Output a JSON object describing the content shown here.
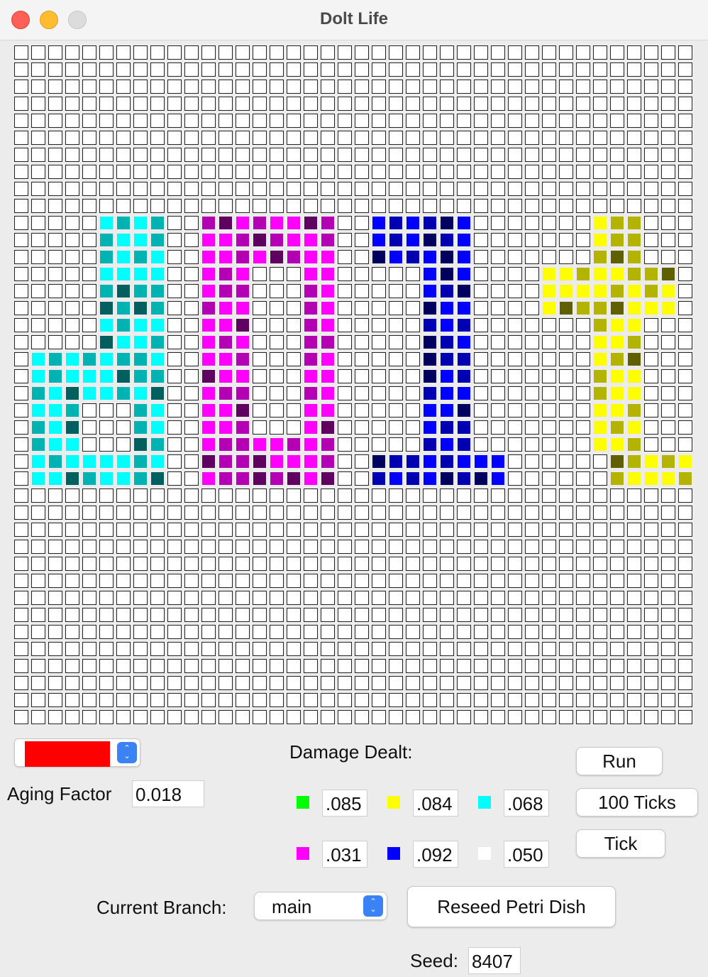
{
  "window": {
    "title": "Dolt Life"
  },
  "grid": {
    "cols": 40,
    "rows": 40,
    "palette": {
      "c1": "#00ffff",
      "c2": "#00b3b3",
      "c3": "#006060",
      "m1": "#ff00ff",
      "m2": "#b300b3",
      "m3": "#600060",
      "b1": "#0000ff",
      "b2": "#0000b3",
      "b3": "#000060",
      "y1": "#ffff00",
      "y2": "#b3b300",
      "y3": "#606000"
    },
    "live_rows": {
      "10": [
        [
          5,
          "c1"
        ],
        [
          6,
          "c2"
        ],
        [
          7,
          "c1"
        ],
        [
          8,
          "c2"
        ],
        [
          11,
          "m2"
        ],
        [
          12,
          "m3"
        ],
        [
          13,
          "m1"
        ],
        [
          14,
          "m2"
        ],
        [
          15,
          "m1"
        ],
        [
          16,
          "m1"
        ],
        [
          17,
          "m3"
        ],
        [
          18,
          "m2"
        ],
        [
          21,
          "b1"
        ],
        [
          22,
          "b2"
        ],
        [
          23,
          "b1"
        ],
        [
          24,
          "b2"
        ],
        [
          25,
          "b3"
        ],
        [
          26,
          "b1"
        ],
        [
          34,
          "y1"
        ],
        [
          35,
          "y2"
        ],
        [
          36,
          "y2"
        ]
      ],
      "11": [
        [
          5,
          "c2"
        ],
        [
          6,
          "c1"
        ],
        [
          7,
          "c1"
        ],
        [
          8,
          "c2"
        ],
        [
          11,
          "m1"
        ],
        [
          12,
          "m1"
        ],
        [
          13,
          "m2"
        ],
        [
          14,
          "m3"
        ],
        [
          15,
          "m2"
        ],
        [
          16,
          "m1"
        ],
        [
          17,
          "m1"
        ],
        [
          18,
          "m2"
        ],
        [
          21,
          "b1"
        ],
        [
          22,
          "b2"
        ],
        [
          23,
          "b1"
        ],
        [
          24,
          "b3"
        ],
        [
          25,
          "b2"
        ],
        [
          26,
          "b1"
        ],
        [
          34,
          "y1"
        ],
        [
          35,
          "y2"
        ],
        [
          36,
          "y2"
        ]
      ],
      "12": [
        [
          5,
          "c2"
        ],
        [
          6,
          "c1"
        ],
        [
          7,
          "c2"
        ],
        [
          8,
          "c1"
        ],
        [
          11,
          "m1"
        ],
        [
          12,
          "m1"
        ],
        [
          13,
          "m2"
        ],
        [
          14,
          "m1"
        ],
        [
          15,
          "m3"
        ],
        [
          16,
          "m2"
        ],
        [
          17,
          "m1"
        ],
        [
          18,
          "m1"
        ],
        [
          21,
          "b3"
        ],
        [
          22,
          "b1"
        ],
        [
          23,
          "b2"
        ],
        [
          24,
          "b1"
        ],
        [
          25,
          "b3"
        ],
        [
          26,
          "b1"
        ],
        [
          34,
          "y2"
        ],
        [
          35,
          "y3"
        ],
        [
          36,
          "y2"
        ]
      ],
      "13": [
        [
          5,
          "c1"
        ],
        [
          6,
          "c1"
        ],
        [
          7,
          "c1"
        ],
        [
          8,
          "c1"
        ],
        [
          11,
          "m1"
        ],
        [
          12,
          "m2"
        ],
        [
          13,
          "m1"
        ],
        [
          17,
          "m1"
        ],
        [
          18,
          "m1"
        ],
        [
          24,
          "b1"
        ],
        [
          25,
          "b3"
        ],
        [
          26,
          "b1"
        ],
        [
          31,
          "y1"
        ],
        [
          32,
          "y1"
        ],
        [
          33,
          "y2"
        ],
        [
          34,
          "y1"
        ],
        [
          35,
          "y1"
        ],
        [
          36,
          "y2"
        ],
        [
          37,
          "y2"
        ],
        [
          38,
          "y3"
        ]
      ],
      "14": [
        [
          5,
          "c2"
        ],
        [
          6,
          "c3"
        ],
        [
          7,
          "c2"
        ],
        [
          8,
          "c2"
        ],
        [
          11,
          "m1"
        ],
        [
          12,
          "m2"
        ],
        [
          13,
          "m2"
        ],
        [
          17,
          "m2"
        ],
        [
          18,
          "m1"
        ],
        [
          24,
          "b1"
        ],
        [
          25,
          "b2"
        ],
        [
          26,
          "b3"
        ],
        [
          31,
          "y1"
        ],
        [
          32,
          "y1"
        ],
        [
          33,
          "y1"
        ],
        [
          34,
          "y1"
        ],
        [
          35,
          "y2"
        ],
        [
          36,
          "y1"
        ],
        [
          37,
          "y2"
        ],
        [
          38,
          "y1"
        ]
      ],
      "15": [
        [
          5,
          "c3"
        ],
        [
          6,
          "c2"
        ],
        [
          7,
          "c3"
        ],
        [
          8,
          "c2"
        ],
        [
          11,
          "m2"
        ],
        [
          12,
          "m1"
        ],
        [
          13,
          "m1"
        ],
        [
          17,
          "m2"
        ],
        [
          18,
          "m1"
        ],
        [
          24,
          "b3"
        ],
        [
          25,
          "b1"
        ],
        [
          26,
          "b1"
        ],
        [
          31,
          "y1"
        ],
        [
          32,
          "y3"
        ],
        [
          33,
          "y2"
        ],
        [
          34,
          "y2"
        ],
        [
          35,
          "y3"
        ],
        [
          36,
          "y1"
        ],
        [
          37,
          "y1"
        ],
        [
          38,
          "y1"
        ]
      ],
      "16": [
        [
          5,
          "c1"
        ],
        [
          6,
          "c2"
        ],
        [
          7,
          "c1"
        ],
        [
          8,
          "c1"
        ],
        [
          11,
          "m1"
        ],
        [
          12,
          "m1"
        ],
        [
          13,
          "m3"
        ],
        [
          17,
          "m2"
        ],
        [
          18,
          "m1"
        ],
        [
          24,
          "b2"
        ],
        [
          25,
          "b1"
        ],
        [
          26,
          "b2"
        ],
        [
          34,
          "y2"
        ],
        [
          35,
          "y1"
        ],
        [
          36,
          "y1"
        ]
      ],
      "17": [
        [
          5,
          "c3"
        ],
        [
          6,
          "c1"
        ],
        [
          7,
          "c1"
        ],
        [
          8,
          "c2"
        ],
        [
          11,
          "m1"
        ],
        [
          12,
          "m2"
        ],
        [
          13,
          "m1"
        ],
        [
          17,
          "m2"
        ],
        [
          18,
          "m2"
        ],
        [
          24,
          "b3"
        ],
        [
          25,
          "b2"
        ],
        [
          26,
          "b1"
        ],
        [
          34,
          "y1"
        ],
        [
          35,
          "y1"
        ],
        [
          36,
          "y2"
        ]
      ],
      "18": [
        [
          1,
          "c1"
        ],
        [
          2,
          "c2"
        ],
        [
          3,
          "c1"
        ],
        [
          4,
          "c2"
        ],
        [
          5,
          "c1"
        ],
        [
          6,
          "c2"
        ],
        [
          7,
          "c2"
        ],
        [
          8,
          "c1"
        ],
        [
          11,
          "m1"
        ],
        [
          12,
          "m1"
        ],
        [
          13,
          "m2"
        ],
        [
          17,
          "m2"
        ],
        [
          18,
          "m1"
        ],
        [
          24,
          "b3"
        ],
        [
          25,
          "b2"
        ],
        [
          26,
          "b2"
        ],
        [
          34,
          "y1"
        ],
        [
          35,
          "y2"
        ],
        [
          36,
          "y3"
        ]
      ],
      "19": [
        [
          1,
          "c1"
        ],
        [
          2,
          "c2"
        ],
        [
          3,
          "c1"
        ],
        [
          4,
          "c1"
        ],
        [
          5,
          "c1"
        ],
        [
          6,
          "c3"
        ],
        [
          7,
          "c2"
        ],
        [
          8,
          "c2"
        ],
        [
          11,
          "m3"
        ],
        [
          12,
          "m1"
        ],
        [
          13,
          "m1"
        ],
        [
          17,
          "m1"
        ],
        [
          18,
          "m1"
        ],
        [
          24,
          "b3"
        ],
        [
          25,
          "b1"
        ],
        [
          26,
          "b2"
        ],
        [
          34,
          "y2"
        ],
        [
          35,
          "y1"
        ],
        [
          36,
          "y1"
        ]
      ],
      "20": [
        [
          1,
          "c2"
        ],
        [
          2,
          "c1"
        ],
        [
          3,
          "c3"
        ],
        [
          4,
          "c1"
        ],
        [
          5,
          "c1"
        ],
        [
          6,
          "c2"
        ],
        [
          7,
          "c1"
        ],
        [
          8,
          "c3"
        ],
        [
          11,
          "m1"
        ],
        [
          12,
          "m2"
        ],
        [
          13,
          "m2"
        ],
        [
          17,
          "m2"
        ],
        [
          18,
          "m1"
        ],
        [
          24,
          "b2"
        ],
        [
          25,
          "b1"
        ],
        [
          26,
          "b1"
        ],
        [
          34,
          "y2"
        ],
        [
          35,
          "y1"
        ],
        [
          36,
          "y1"
        ]
      ],
      "21": [
        [
          1,
          "c1"
        ],
        [
          2,
          "c1"
        ],
        [
          3,
          "c2"
        ],
        [
          7,
          "c2"
        ],
        [
          8,
          "c1"
        ],
        [
          11,
          "m1"
        ],
        [
          12,
          "m1"
        ],
        [
          13,
          "m3"
        ],
        [
          17,
          "m1"
        ],
        [
          18,
          "m1"
        ],
        [
          24,
          "b1"
        ],
        [
          25,
          "b1"
        ],
        [
          26,
          "b3"
        ],
        [
          34,
          "y1"
        ],
        [
          35,
          "y1"
        ],
        [
          36,
          "y2"
        ]
      ],
      "22": [
        [
          1,
          "c2"
        ],
        [
          2,
          "c1"
        ],
        [
          3,
          "c3"
        ],
        [
          7,
          "c2"
        ],
        [
          8,
          "c1"
        ],
        [
          11,
          "m1"
        ],
        [
          12,
          "m1"
        ],
        [
          13,
          "m2"
        ],
        [
          17,
          "m1"
        ],
        [
          18,
          "m3"
        ],
        [
          24,
          "b1"
        ],
        [
          25,
          "b2"
        ],
        [
          26,
          "b2"
        ],
        [
          34,
          "y1"
        ],
        [
          35,
          "y2"
        ],
        [
          36,
          "y1"
        ]
      ],
      "23": [
        [
          1,
          "c2"
        ],
        [
          2,
          "c1"
        ],
        [
          3,
          "c1"
        ],
        [
          7,
          "c3"
        ],
        [
          8,
          "c2"
        ],
        [
          11,
          "m1"
        ],
        [
          12,
          "m2"
        ],
        [
          13,
          "m2"
        ],
        [
          14,
          "m1"
        ],
        [
          15,
          "m1"
        ],
        [
          16,
          "m2"
        ],
        [
          17,
          "m1"
        ],
        [
          18,
          "m2"
        ],
        [
          24,
          "b2"
        ],
        [
          25,
          "b1"
        ],
        [
          26,
          "b2"
        ],
        [
          34,
          "y1"
        ],
        [
          35,
          "y1"
        ],
        [
          36,
          "y2"
        ]
      ],
      "24": [
        [
          1,
          "c1"
        ],
        [
          2,
          "c2"
        ],
        [
          3,
          "c1"
        ],
        [
          4,
          "c1"
        ],
        [
          5,
          "c1"
        ],
        [
          6,
          "c1"
        ],
        [
          7,
          "c2"
        ],
        [
          8,
          "c1"
        ],
        [
          11,
          "m3"
        ],
        [
          12,
          "m2"
        ],
        [
          13,
          "m2"
        ],
        [
          14,
          "m3"
        ],
        [
          15,
          "m1"
        ],
        [
          16,
          "m1"
        ],
        [
          17,
          "m1"
        ],
        [
          18,
          "m2"
        ],
        [
          21,
          "b3"
        ],
        [
          22,
          "b2"
        ],
        [
          23,
          "b2"
        ],
        [
          24,
          "b1"
        ],
        [
          25,
          "b2"
        ],
        [
          26,
          "b1"
        ],
        [
          27,
          "b1"
        ],
        [
          28,
          "b1"
        ],
        [
          35,
          "y3"
        ],
        [
          36,
          "y2"
        ],
        [
          37,
          "y1"
        ],
        [
          38,
          "y2"
        ],
        [
          39,
          "y1"
        ]
      ],
      "25": [
        [
          1,
          "c1"
        ],
        [
          2,
          "c1"
        ],
        [
          3,
          "c3"
        ],
        [
          4,
          "c2"
        ],
        [
          5,
          "c1"
        ],
        [
          6,
          "c1"
        ],
        [
          7,
          "c2"
        ],
        [
          8,
          "c3"
        ],
        [
          11,
          "m1"
        ],
        [
          12,
          "m2"
        ],
        [
          13,
          "m2"
        ],
        [
          14,
          "m3"
        ],
        [
          15,
          "m2"
        ],
        [
          16,
          "m3"
        ],
        [
          17,
          "m1"
        ],
        [
          18,
          "m3"
        ],
        [
          21,
          "b2"
        ],
        [
          22,
          "b1"
        ],
        [
          23,
          "b2"
        ],
        [
          24,
          "b1"
        ],
        [
          25,
          "b3"
        ],
        [
          26,
          "b2"
        ],
        [
          27,
          "b3"
        ],
        [
          28,
          "b1"
        ],
        [
          35,
          "y2"
        ],
        [
          36,
          "y1"
        ],
        [
          37,
          "y1"
        ],
        [
          38,
          "y1"
        ],
        [
          39,
          "y2"
        ]
      ]
    }
  },
  "controls": {
    "color_swatch": "#ff0000",
    "aging_label": "Aging Factor",
    "aging_value": "0.018",
    "damage_label": "Damage Dealt:",
    "damage": [
      {
        "color": "#00ff00",
        "value": ".085"
      },
      {
        "color": "#ffff00",
        "value": ".084"
      },
      {
        "color": "#00ffff",
        "value": ".068"
      },
      {
        "color": "#ff00ff",
        "value": ".031"
      },
      {
        "color": "#0000ff",
        "value": ".092"
      },
      {
        "color": "#ffffff",
        "value": ".050"
      }
    ],
    "run_label": "Run",
    "ticks_label": "100 Ticks",
    "tick_label": "Tick",
    "branch_label": "Current Branch:",
    "branch_value": "main",
    "reseed_label": "Reseed Petri Dish",
    "seed_label": "Seed:",
    "seed_value": "8407"
  }
}
